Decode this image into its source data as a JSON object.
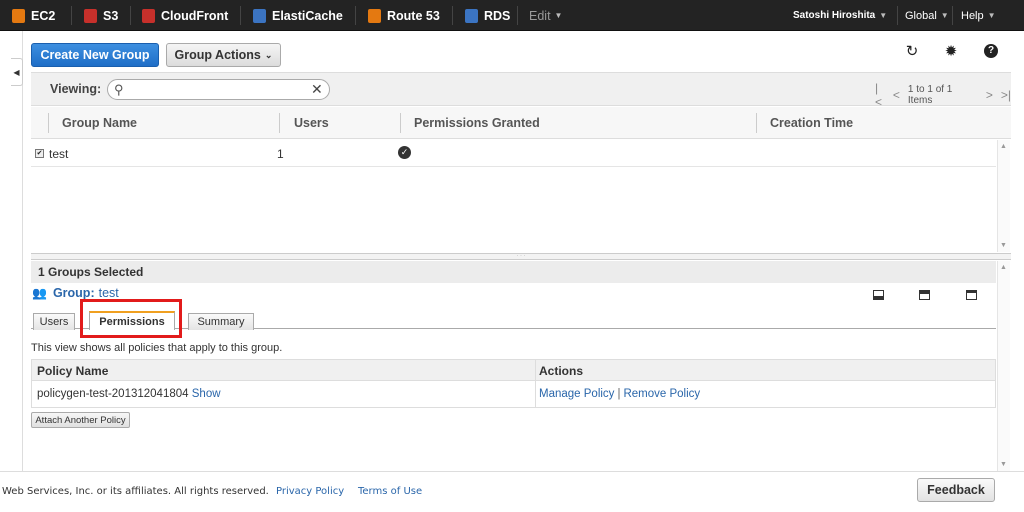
{
  "nav": {
    "items": [
      {
        "label": "EC2",
        "icon": "ec2-icon",
        "color": "#e47911"
      },
      {
        "label": "S3",
        "icon": "s3-icon",
        "color": "#c7302b"
      },
      {
        "label": "CloudFront",
        "icon": "cloudfront-icon",
        "color": "#c7302b"
      },
      {
        "label": "ElastiCache",
        "icon": "elasticache-icon",
        "color": "#3b74c2"
      },
      {
        "label": "Route 53",
        "icon": "route53-icon",
        "color": "#e47911"
      },
      {
        "label": "RDS",
        "icon": "rds-icon",
        "color": "#3b74c2"
      }
    ],
    "edit_label": "Edit",
    "user_label": "Satoshi Hiroshita",
    "region_label": "Global",
    "help_label": "Help"
  },
  "toolbar": {
    "create_label": "Create New Group",
    "actions_label": "Group Actions",
    "refresh_icon": "refresh-icon",
    "settings_icon": "gear-icon",
    "help_icon": "help-icon"
  },
  "filter": {
    "viewing_label": "Viewing:",
    "search_value": "",
    "pager_text": "1 to 1 of 1 Items"
  },
  "table": {
    "columns": [
      "Group Name",
      "Users",
      "Permissions Granted",
      "Creation Time"
    ],
    "rows": [
      {
        "name": "test",
        "users": "1",
        "permissions": "granted",
        "created": ""
      }
    ]
  },
  "details": {
    "selected_label": "1 Groups Selected",
    "group_label": "Group:",
    "group_name": "test",
    "tabs": [
      "Users",
      "Permissions",
      "Summary"
    ],
    "active_tab": "Permissions",
    "description": "This view shows all policies that apply to this group.",
    "policy_columns": [
      "Policy Name",
      "Actions"
    ],
    "policies": [
      {
        "name": "policygen-test-201312041804",
        "show_label": "Show",
        "manage_label": "Manage Policy",
        "remove_label": "Remove Policy"
      }
    ],
    "attach_label": "Attach Another Policy"
  },
  "footer": {
    "copyright": "Web Services, Inc. or its affiliates. All rights reserved.",
    "privacy_label": "Privacy Policy",
    "terms_label": "Terms of Use",
    "feedback_label": "Feedback"
  }
}
